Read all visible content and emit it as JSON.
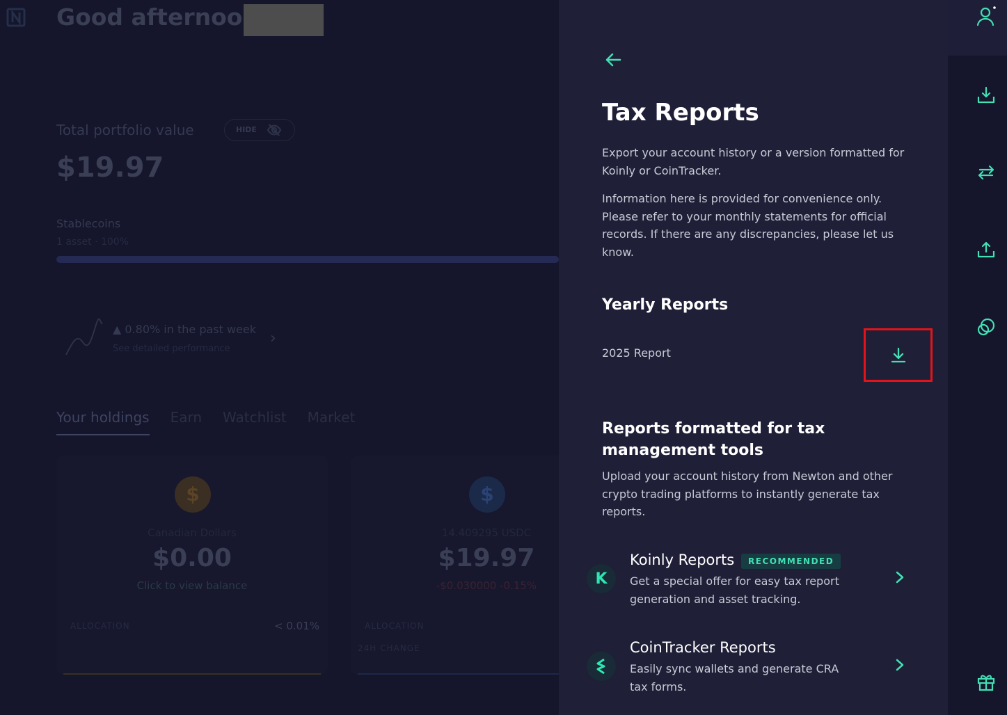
{
  "background": {
    "greeting": "Good afternoon,",
    "total_portfolio_label": "Total portfolio value",
    "hide_label": "HIDE",
    "portfolio_value": "$19.97",
    "stablecoins_label": "Stablecoins",
    "assets_summary": "1 asset · 100%",
    "performance_text": "▲ 0.80% in the past week",
    "performance_sub": "See detailed performance",
    "tabs": [
      "Your holdings",
      "Earn",
      "Watchlist",
      "Market"
    ],
    "cards": [
      {
        "name": "Canadian Dollars",
        "balance": "$0.00",
        "sub": "Click to view balance",
        "allocation_label": "ALLOCATION",
        "allocation_value": "< 0.01%"
      },
      {
        "name": "14.409295 USDC",
        "balance": "$19.97",
        "sub": "-$0.030000  -0.15%",
        "allocation_label": "ALLOCATION",
        "change_label": "24H CHANGE"
      }
    ]
  },
  "panel": {
    "back_icon": "arrow-left-icon",
    "title": "Tax Reports",
    "description_1": "Export your account history or a version formatted for Koinly or CoinTracker.",
    "description_2": "Information here is provided for convenience only. Please refer to your monthly statements for official records. If there are any discrepancies, please let us know.",
    "yearly_heading": "Yearly Reports",
    "yearly_reports": [
      {
        "label": "2025 Report",
        "action_icon": "download-icon"
      }
    ],
    "tools_heading": "Reports formatted for tax management tools",
    "tools_description": "Upload your account history from Newton and other crypto trading platforms to instantly generate tax reports.",
    "tools": [
      {
        "name": "Koinly Reports",
        "badge": "RECOMMENDED",
        "logo": "K",
        "description": "Get a special offer for easy tax report generation and asset tracking."
      },
      {
        "name": "CoinTracker Reports",
        "logo": "≡",
        "description": "Easily sync wallets and generate CRA tax forms."
      }
    ]
  },
  "rail": {
    "icons": [
      "user-icon",
      "deposit-icon",
      "transfer-icon",
      "withdraw-icon",
      "chat-icon",
      "gift-icon"
    ]
  },
  "colors": {
    "accent": "#43e0b3",
    "panel_bg": "#1f1f38",
    "page_bg": "#15152b",
    "highlight_box": "#e2141a"
  }
}
